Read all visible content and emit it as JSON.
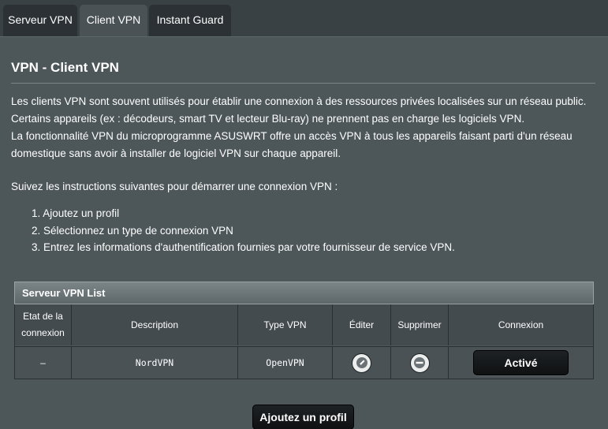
{
  "tabs": [
    {
      "label": "Serveur VPN",
      "active": false
    },
    {
      "label": "Client VPN",
      "active": true
    },
    {
      "label": "Instant Guard",
      "active": false
    }
  ],
  "page": {
    "title": "VPN - Client VPN",
    "intro_lines": [
      "Les clients VPN sont souvent utilisés pour établir une connexion à des ressources privées localisées sur un réseau public.",
      "Certains appareils (ex : décodeurs, smart TV et lecteur Blu-ray) ne prennent pas en charge les logiciels VPN.",
      "La fonctionnalité VPN du microprogramme ASUSWRT offre un accès VPN à tous les appareils faisant parti d'un réseau",
      "domestique sans avoir à installer de logiciel VPN sur chaque appareil."
    ],
    "instructions_intro": "Suivez les instructions suivantes pour démarrer une connexion VPN :",
    "steps": [
      "1. Ajoutez un profil",
      "2. Sélectionnez un type de connexion VPN",
      "3. Entrez les informations d'authentification fournies par votre fournisseur de service VPN."
    ]
  },
  "table": {
    "caption": "Serveur VPN List",
    "headers": {
      "status_line1": "Etat de la",
      "status_line2": "connexion",
      "description": "Description",
      "vpn_type": "Type VPN",
      "edit": "Éditer",
      "delete": "Supprimer",
      "connection": "Connexion"
    },
    "rows": [
      {
        "status": "–",
        "description": "NordVPN",
        "vpn_type": "OpenVPN",
        "edit_icon": "pencil-icon",
        "delete_icon": "minus-circle-icon",
        "connection_button": "Activé"
      }
    ]
  },
  "actions": {
    "add_profile": "Ajoutez un profil"
  },
  "colors": {
    "background": "#3a4145",
    "panel": "#4d5659",
    "button": "#15181a",
    "text": "#ffffff"
  }
}
